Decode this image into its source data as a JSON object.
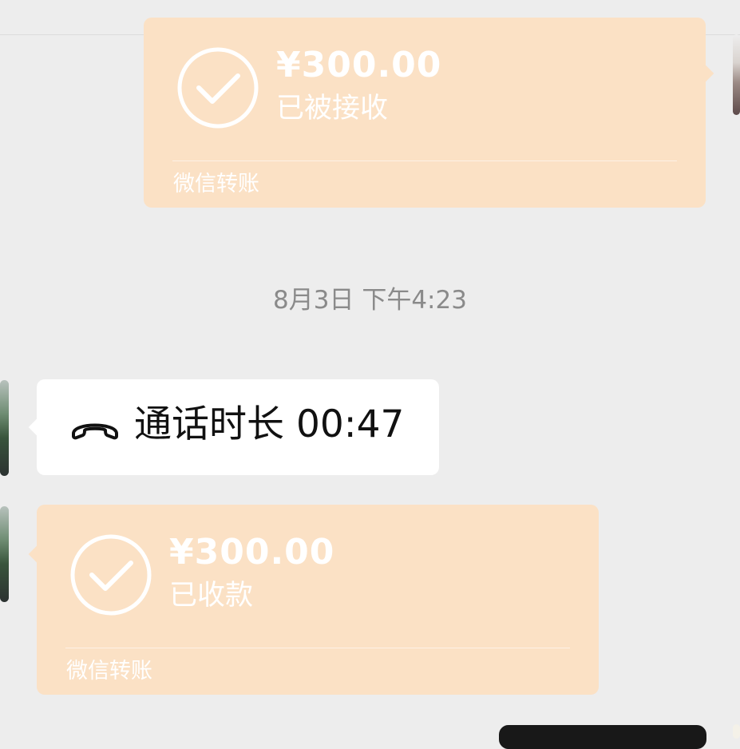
{
  "messages": [
    {
      "type": "transfer",
      "side": "right",
      "amount": "¥300.00",
      "status": "已被接收",
      "service": "微信转账",
      "icon": "check-circle-icon"
    },
    {
      "type": "timestamp",
      "text": "8月3日 下午4:23"
    },
    {
      "type": "call",
      "side": "left",
      "text": "通话时长 00:47",
      "icon": "phone-hangup-icon"
    },
    {
      "type": "transfer",
      "side": "left",
      "amount": "¥300.00",
      "status": "已收款",
      "service": "微信转账",
      "icon": "check-circle-icon"
    }
  ],
  "colors": {
    "background": "#ededed",
    "transfer_bubble": "#fbe1c5",
    "call_bubble": "#ffffff",
    "timestamp_text": "#8a8a8a"
  }
}
